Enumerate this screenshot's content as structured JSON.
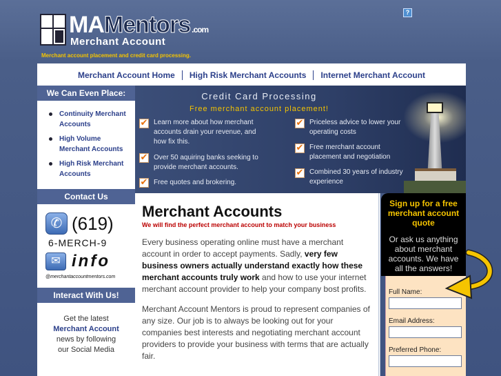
{
  "brand": {
    "logo_main": "MA",
    "logo_rest": "Mentors",
    "logo_tld": ".com",
    "logo_sub": "Merchant Account",
    "tagline": "Merchant account placement and credit card processing."
  },
  "help_icon": "?",
  "nav": {
    "items": [
      "Merchant Account Home",
      "High Risk Merchant Accounts",
      "Internet Merchant Account"
    ]
  },
  "sidebar": {
    "place_heading": "We Can Even Place:",
    "place_items": [
      "Continuity Merchant Accounts",
      "High Volume Merchant Accounts",
      "High Risk Merchant Accounts"
    ],
    "contact_heading": "Contact Us",
    "phone_area": "(619)",
    "phone_word": "6-MERCH-9",
    "mail_word": "info",
    "mail_domain": "@merchantaccountmentors.com",
    "interact_heading": "Interact With Us!",
    "social_line1": "Get the latest",
    "social_link": "Merchant Account",
    "social_line2": "news by following",
    "social_line3": "our Social Media"
  },
  "banner": {
    "title": "Credit Card Processing",
    "subtitle": "Free merchant account placement!",
    "features_left": [
      "Learn more about how merchant accounts drain your revenue, and how fix this.",
      "Over 50 aquiring banks seeking to provide merchant accounts.",
      "Free quotes and brokering."
    ],
    "features_right": [
      "Priceless advice to lower your operating costs",
      "Free merchant account placement and negotiation",
      "Combined 30 years of industry experience"
    ],
    "check_glyph": "✔"
  },
  "main": {
    "heading": "Merchant Accounts",
    "subheading": "We will find the perfect merchant account to match your business",
    "p1_a": "Every business operating online must have a merchant account in order to accept payments. Sadly, ",
    "p1_b": "very few business owners actually understand exactly how these merchant accounts truly work",
    "p1_c": " and how to use your internet merchant account provider to help your company bost profits.",
    "p2": "Merchant Account Mentors is proud to represent companies of any size. Our job is to always be looking out for your companies best interests and negotiating merchant account providers to provide your business with terms that are actually fair."
  },
  "signup": {
    "title": "Sign up for a free merchant account quote",
    "text": "Or ask us anything about merchant accounts. We have all the answers!",
    "name_label": "Full Name:",
    "email_label": "Email Address:",
    "phone_label": "Preferred Phone:"
  },
  "icons": {
    "phone": "phone-icon",
    "mail": "envelope-icon",
    "check": "checkmark-icon",
    "arrow": "curved-arrow-icon"
  },
  "colors": {
    "background": "#4a5e88",
    "accent_yellow": "#f5c400",
    "link_blue": "#2b3f8a",
    "alert_red": "#bb0000",
    "form_bg": "#fde3c2"
  }
}
